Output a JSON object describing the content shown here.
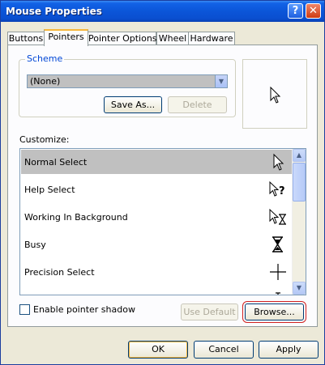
{
  "window": {
    "title": "Mouse Properties",
    "help_glyph": "?",
    "close_glyph": "✕"
  },
  "tabs": [
    {
      "label": "Buttons",
      "active": false
    },
    {
      "label": "Pointers",
      "active": true
    },
    {
      "label": "Pointer Options",
      "active": false
    },
    {
      "label": "Wheel",
      "active": false
    },
    {
      "label": "Hardware",
      "active": false
    }
  ],
  "scheme": {
    "legend": "Scheme",
    "selected": "(None)",
    "save_as_label": "Save As...",
    "delete_label": "Delete"
  },
  "customize": {
    "label": "Customize:",
    "items": [
      {
        "label": "Normal Select",
        "icon": "arrow-pointer-icon",
        "selected": true
      },
      {
        "label": "Help Select",
        "icon": "help-pointer-icon",
        "selected": false
      },
      {
        "label": "Working In Background",
        "icon": "working-pointer-icon",
        "selected": false
      },
      {
        "label": "Busy",
        "icon": "hourglass-icon",
        "selected": false
      },
      {
        "label": "Precision Select",
        "icon": "crosshair-icon",
        "selected": false
      }
    ]
  },
  "shadow": {
    "label": "Enable pointer shadow",
    "checked": false
  },
  "actions": {
    "use_default_label": "Use Default",
    "browse_label": "Browse..."
  },
  "footer": {
    "ok_label": "OK",
    "cancel_label": "Cancel",
    "apply_label": "Apply"
  },
  "colors": {
    "titlebar": "#0a4fd0",
    "selection": "#c0c0c0",
    "focus_outline": "#d02020",
    "legend_text": "#0046d5"
  }
}
